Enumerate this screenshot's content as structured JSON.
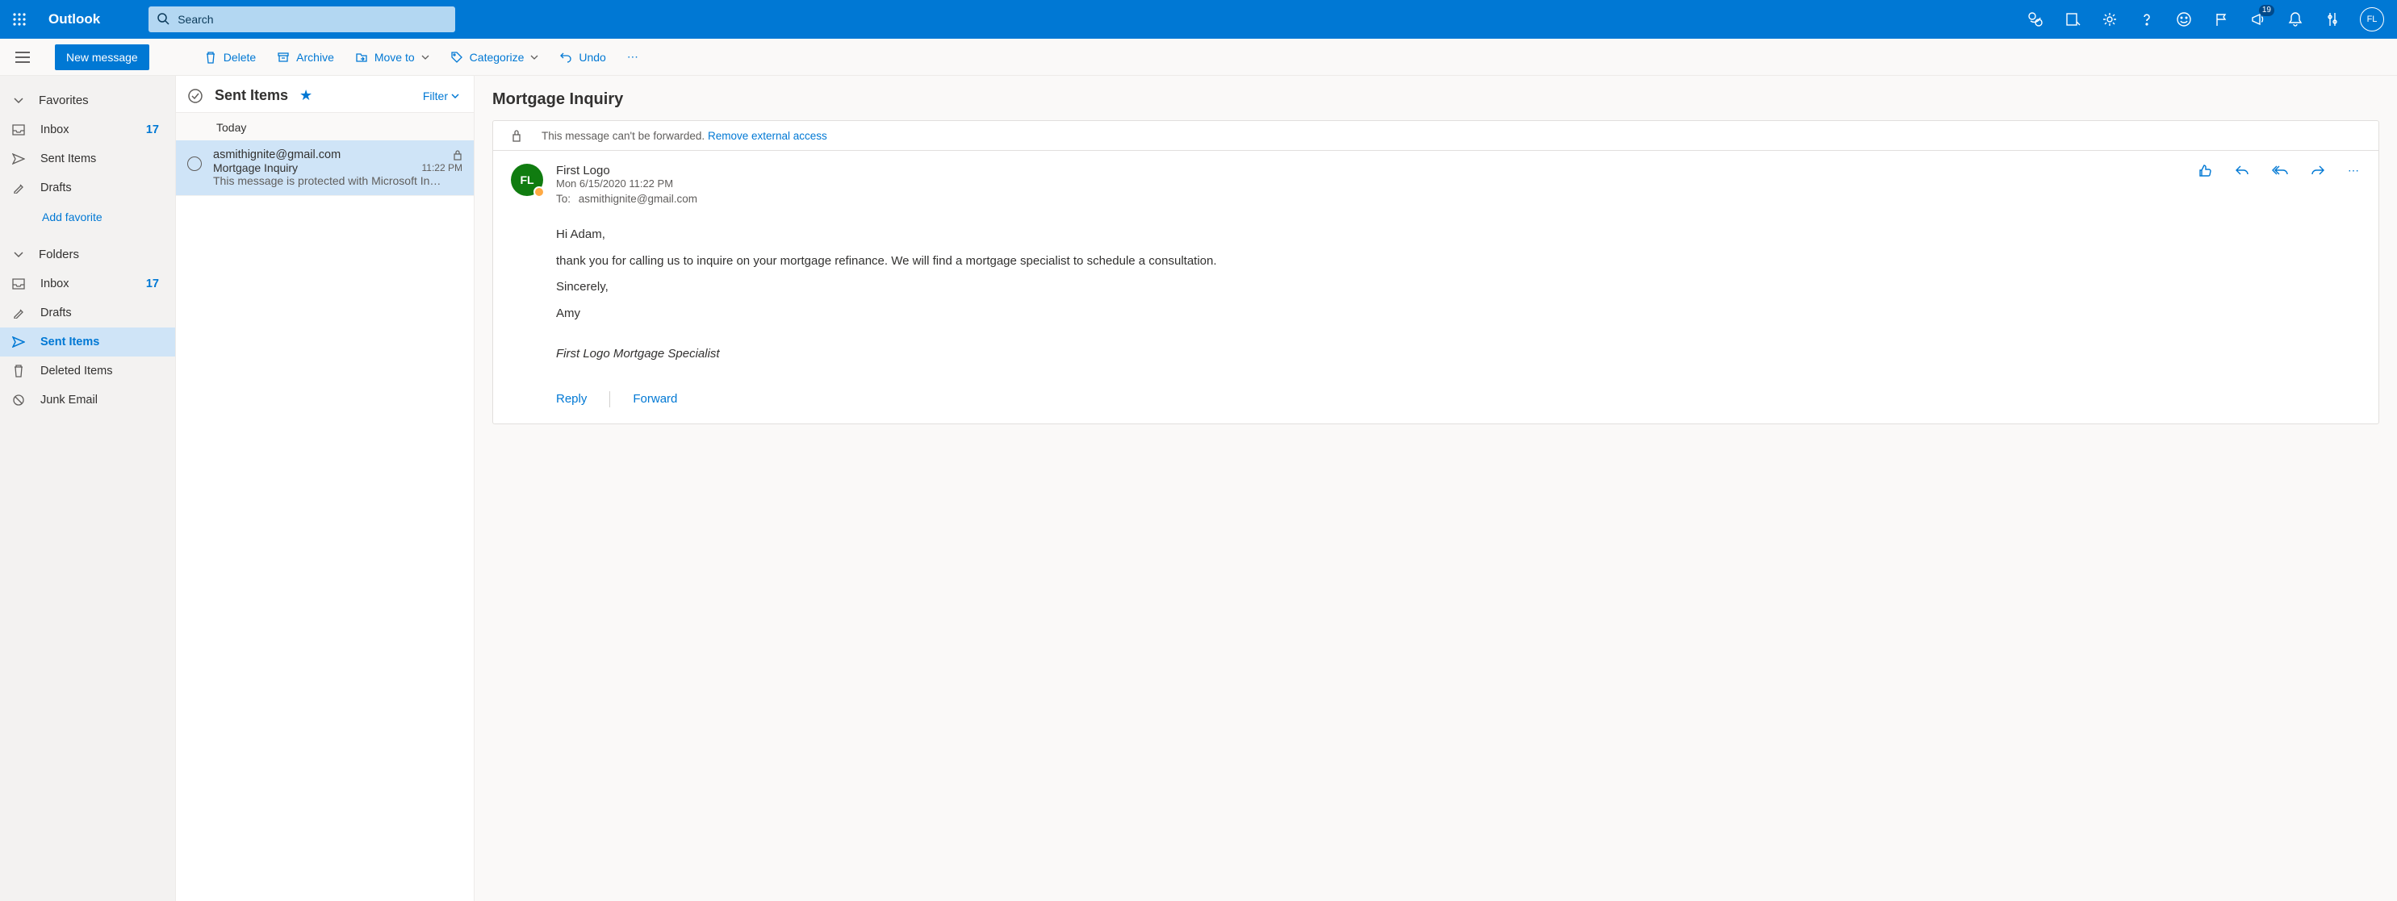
{
  "header": {
    "brand": "Outlook",
    "search_placeholder": "Search",
    "notification_count": "19",
    "avatar_initials": "FL"
  },
  "cmdbar": {
    "new_message": "New message",
    "delete": "Delete",
    "archive": "Archive",
    "move_to": "Move to",
    "categorize": "Categorize",
    "undo": "Undo"
  },
  "nav": {
    "favorites_label": "Favorites",
    "folders_label": "Folders",
    "add_favorite": "Add favorite",
    "items": {
      "fav_inbox": "Inbox",
      "fav_inbox_count": "17",
      "fav_sent": "Sent Items",
      "fav_drafts": "Drafts",
      "inbox": "Inbox",
      "inbox_count": "17",
      "drafts": "Drafts",
      "sent": "Sent Items",
      "deleted": "Deleted Items",
      "junk": "Junk Email"
    }
  },
  "msglist": {
    "title": "Sent Items",
    "filter": "Filter",
    "group": "Today",
    "item": {
      "from": "asmithignite@gmail.com",
      "subject": "Mortgage Inquiry",
      "time": "11:22 PM",
      "preview": "This message is protected with Microsoft In…"
    }
  },
  "reading": {
    "subject": "Mortgage Inquiry",
    "infobar_text": "This message can't be forwarded.",
    "infobar_link": "Remove external access",
    "sender_name": "First Logo",
    "sender_initials": "FL",
    "sent_date": "Mon 6/15/2020 11:22 PM",
    "to_label": "To:",
    "to_value": "asmithignite@gmail.com",
    "body": {
      "p1": "Hi Adam,",
      "p2": " thank you for calling us to inquire on your mortgage refinance.  We will find a mortgage specialist to schedule a consultation.",
      "p3": "Sincerely,",
      "p4": "Amy",
      "sig": "First Logo Mortgage Specialist"
    },
    "reply": "Reply",
    "forward": "Forward"
  }
}
